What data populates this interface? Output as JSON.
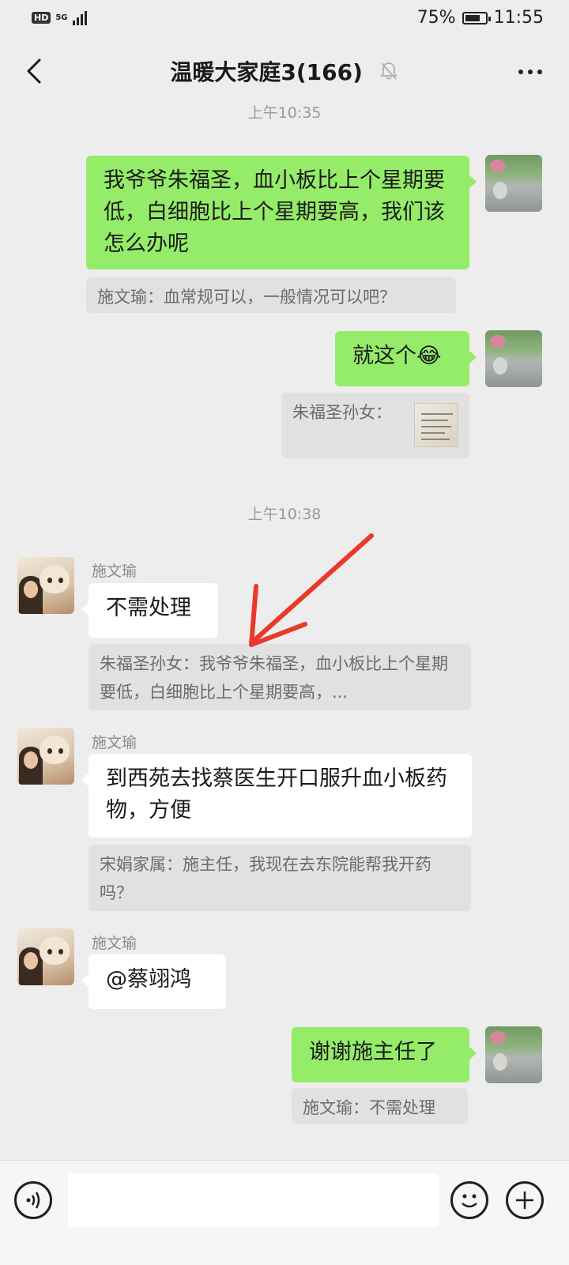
{
  "status_bar": {
    "network_badge": "HD",
    "network_type": "5G",
    "battery_percent": "75%",
    "battery_level": 0.75,
    "time": "11:55"
  },
  "header": {
    "title": "温暖大家庭3(166)",
    "muted": true
  },
  "messages": {
    "time1": "上午10:35",
    "m1_text": "我爷爷朱福圣，血小板比上个星期要低，白细胞比上个星期要高，我们该怎么办呢",
    "q1_text": "施文瑜：血常规可以，一般情况可以吧？",
    "m2_text": "就这个😂",
    "q2_text": "朱福圣孙女：",
    "time2": "上午10:38",
    "s1_name": "施文瑜",
    "m3_text": "不需处理",
    "q3_text": "朱福圣孙女：我爷爷朱福圣，血小板比上个星期要低，白细胞比上个星期要高，...",
    "s2_name": "施文瑜",
    "m4_text": "到西苑去找蔡医生开口服升血小板药物，方便",
    "q4_text": "宋娟家属：施主任，我现在去东院能帮我开药吗？",
    "s3_name": "施文瑜",
    "m5_text": "@蔡翊鸿",
    "m6_text": "谢谢施主任了",
    "q6_text": "施文瑜：不需处理"
  },
  "input_bar": {
    "placeholder": ""
  },
  "colors": {
    "sent_bubble": "#95ec69",
    "received_bubble": "#ffffff",
    "background": "#ededed",
    "annotation_arrow": "#e8392a"
  }
}
